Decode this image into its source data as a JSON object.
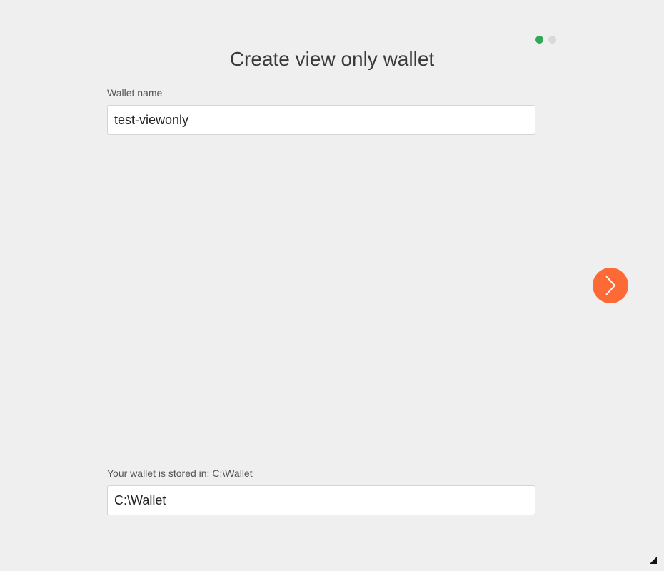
{
  "header": {
    "title": "Create view only wallet",
    "steps": [
      {
        "state": "active",
        "color": "#2eaa57"
      },
      {
        "state": "inactive",
        "color": "#d9d9d9"
      }
    ]
  },
  "wallet_name": {
    "label": "Wallet name",
    "value": "test-viewonly"
  },
  "storage": {
    "label": "Your wallet is stored in: C:\\Wallet",
    "value": "C:\\Wallet"
  },
  "navigation": {
    "next_icon": "chevron-right-icon",
    "next_color": "#fd6a36"
  },
  "window": {
    "grip_icon": "resize-grip-icon"
  }
}
